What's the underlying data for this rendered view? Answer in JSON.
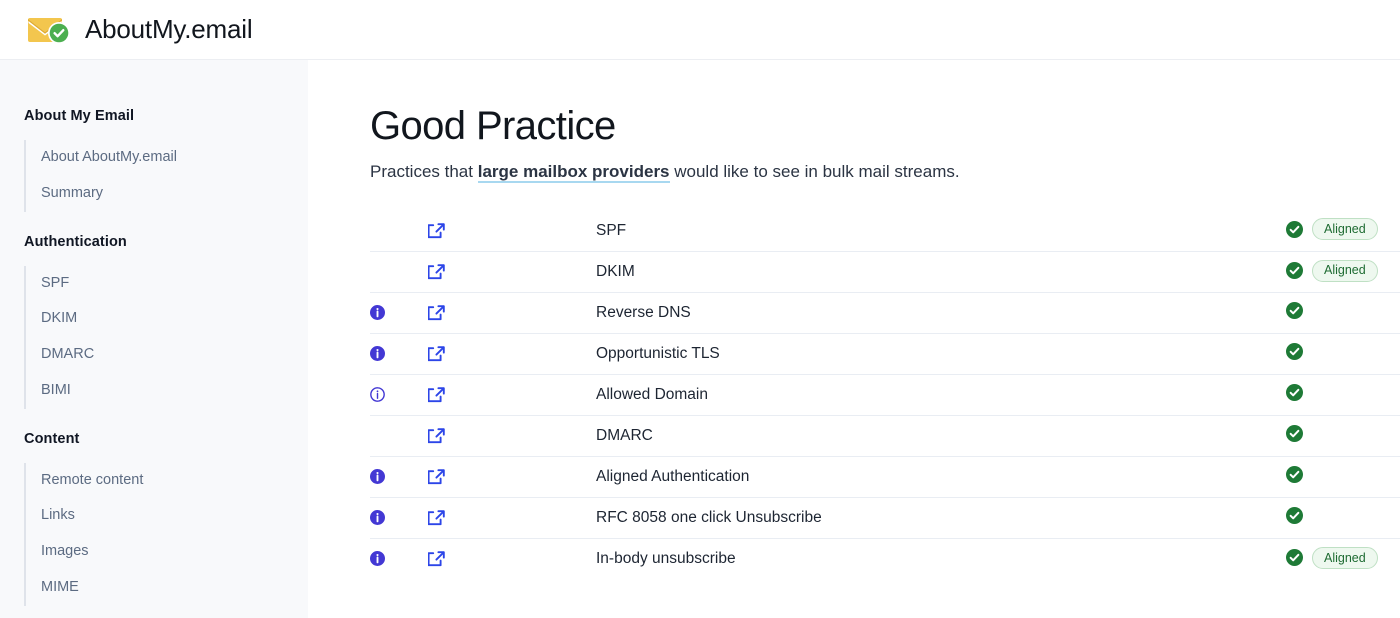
{
  "header": {
    "logo_icon": "envelope-check-logo",
    "brand_name": "AboutMy.email"
  },
  "sidebar": {
    "groups": [
      {
        "heading": "About My Email",
        "items": [
          {
            "label": "About AboutMy.email"
          },
          {
            "label": "Summary"
          }
        ]
      },
      {
        "heading": "Authentication",
        "items": [
          {
            "label": "SPF"
          },
          {
            "label": "DKIM"
          },
          {
            "label": "DMARC"
          },
          {
            "label": "BIMI"
          }
        ]
      },
      {
        "heading": "Content",
        "items": [
          {
            "label": "Remote content"
          },
          {
            "label": "Links"
          },
          {
            "label": "Images"
          },
          {
            "label": "MIME"
          }
        ]
      }
    ]
  },
  "main": {
    "title": "Good Practice",
    "subtitle_before": "Practices that ",
    "subtitle_term": "large mailbox providers",
    "subtitle_after": " would like to see in bulk mail streams.",
    "rows": [
      {
        "name": "SPF",
        "info_icon": "none",
        "link_icon": "external-link-icon",
        "status_icon": "check-circle-icon",
        "badge": "Aligned"
      },
      {
        "name": "DKIM",
        "info_icon": "none",
        "link_icon": "external-link-icon",
        "status_icon": "check-circle-icon",
        "badge": "Aligned"
      },
      {
        "name": "Reverse DNS",
        "info_icon": "info-filled-icon",
        "link_icon": "external-link-icon",
        "status_icon": "check-circle-icon",
        "badge": ""
      },
      {
        "name": "Opportunistic TLS",
        "info_icon": "info-filled-icon",
        "link_icon": "external-link-icon",
        "status_icon": "check-circle-icon",
        "badge": ""
      },
      {
        "name": "Allowed Domain",
        "info_icon": "info-outline-icon",
        "link_icon": "external-link-icon",
        "status_icon": "check-circle-icon",
        "badge": ""
      },
      {
        "name": "DMARC",
        "info_icon": "none",
        "link_icon": "external-link-icon",
        "status_icon": "check-circle-icon",
        "badge": ""
      },
      {
        "name": "Aligned Authentication",
        "info_icon": "info-filled-icon",
        "link_icon": "external-link-icon",
        "status_icon": "check-circle-icon",
        "badge": ""
      },
      {
        "name": "RFC 8058 one click Unsubscribe",
        "info_icon": "info-filled-icon",
        "link_icon": "external-link-icon",
        "status_icon": "check-circle-icon",
        "badge": ""
      },
      {
        "name": "In-body unsubscribe",
        "info_icon": "info-filled-icon",
        "link_icon": "external-link-icon",
        "status_icon": "check-circle-icon",
        "badge": "Aligned"
      }
    ]
  },
  "colors": {
    "accent_blue": "#2c45e8",
    "info_purple": "#4338d4",
    "success_green": "#1e7a36",
    "badge_bg": "#eef8ef",
    "badge_border": "#bfe0c4",
    "logo_yellow": "#f5ca57",
    "logo_green": "#4caf50",
    "sidebar_bg": "#f8f9fb",
    "term_underline": "#a8d8f0"
  }
}
